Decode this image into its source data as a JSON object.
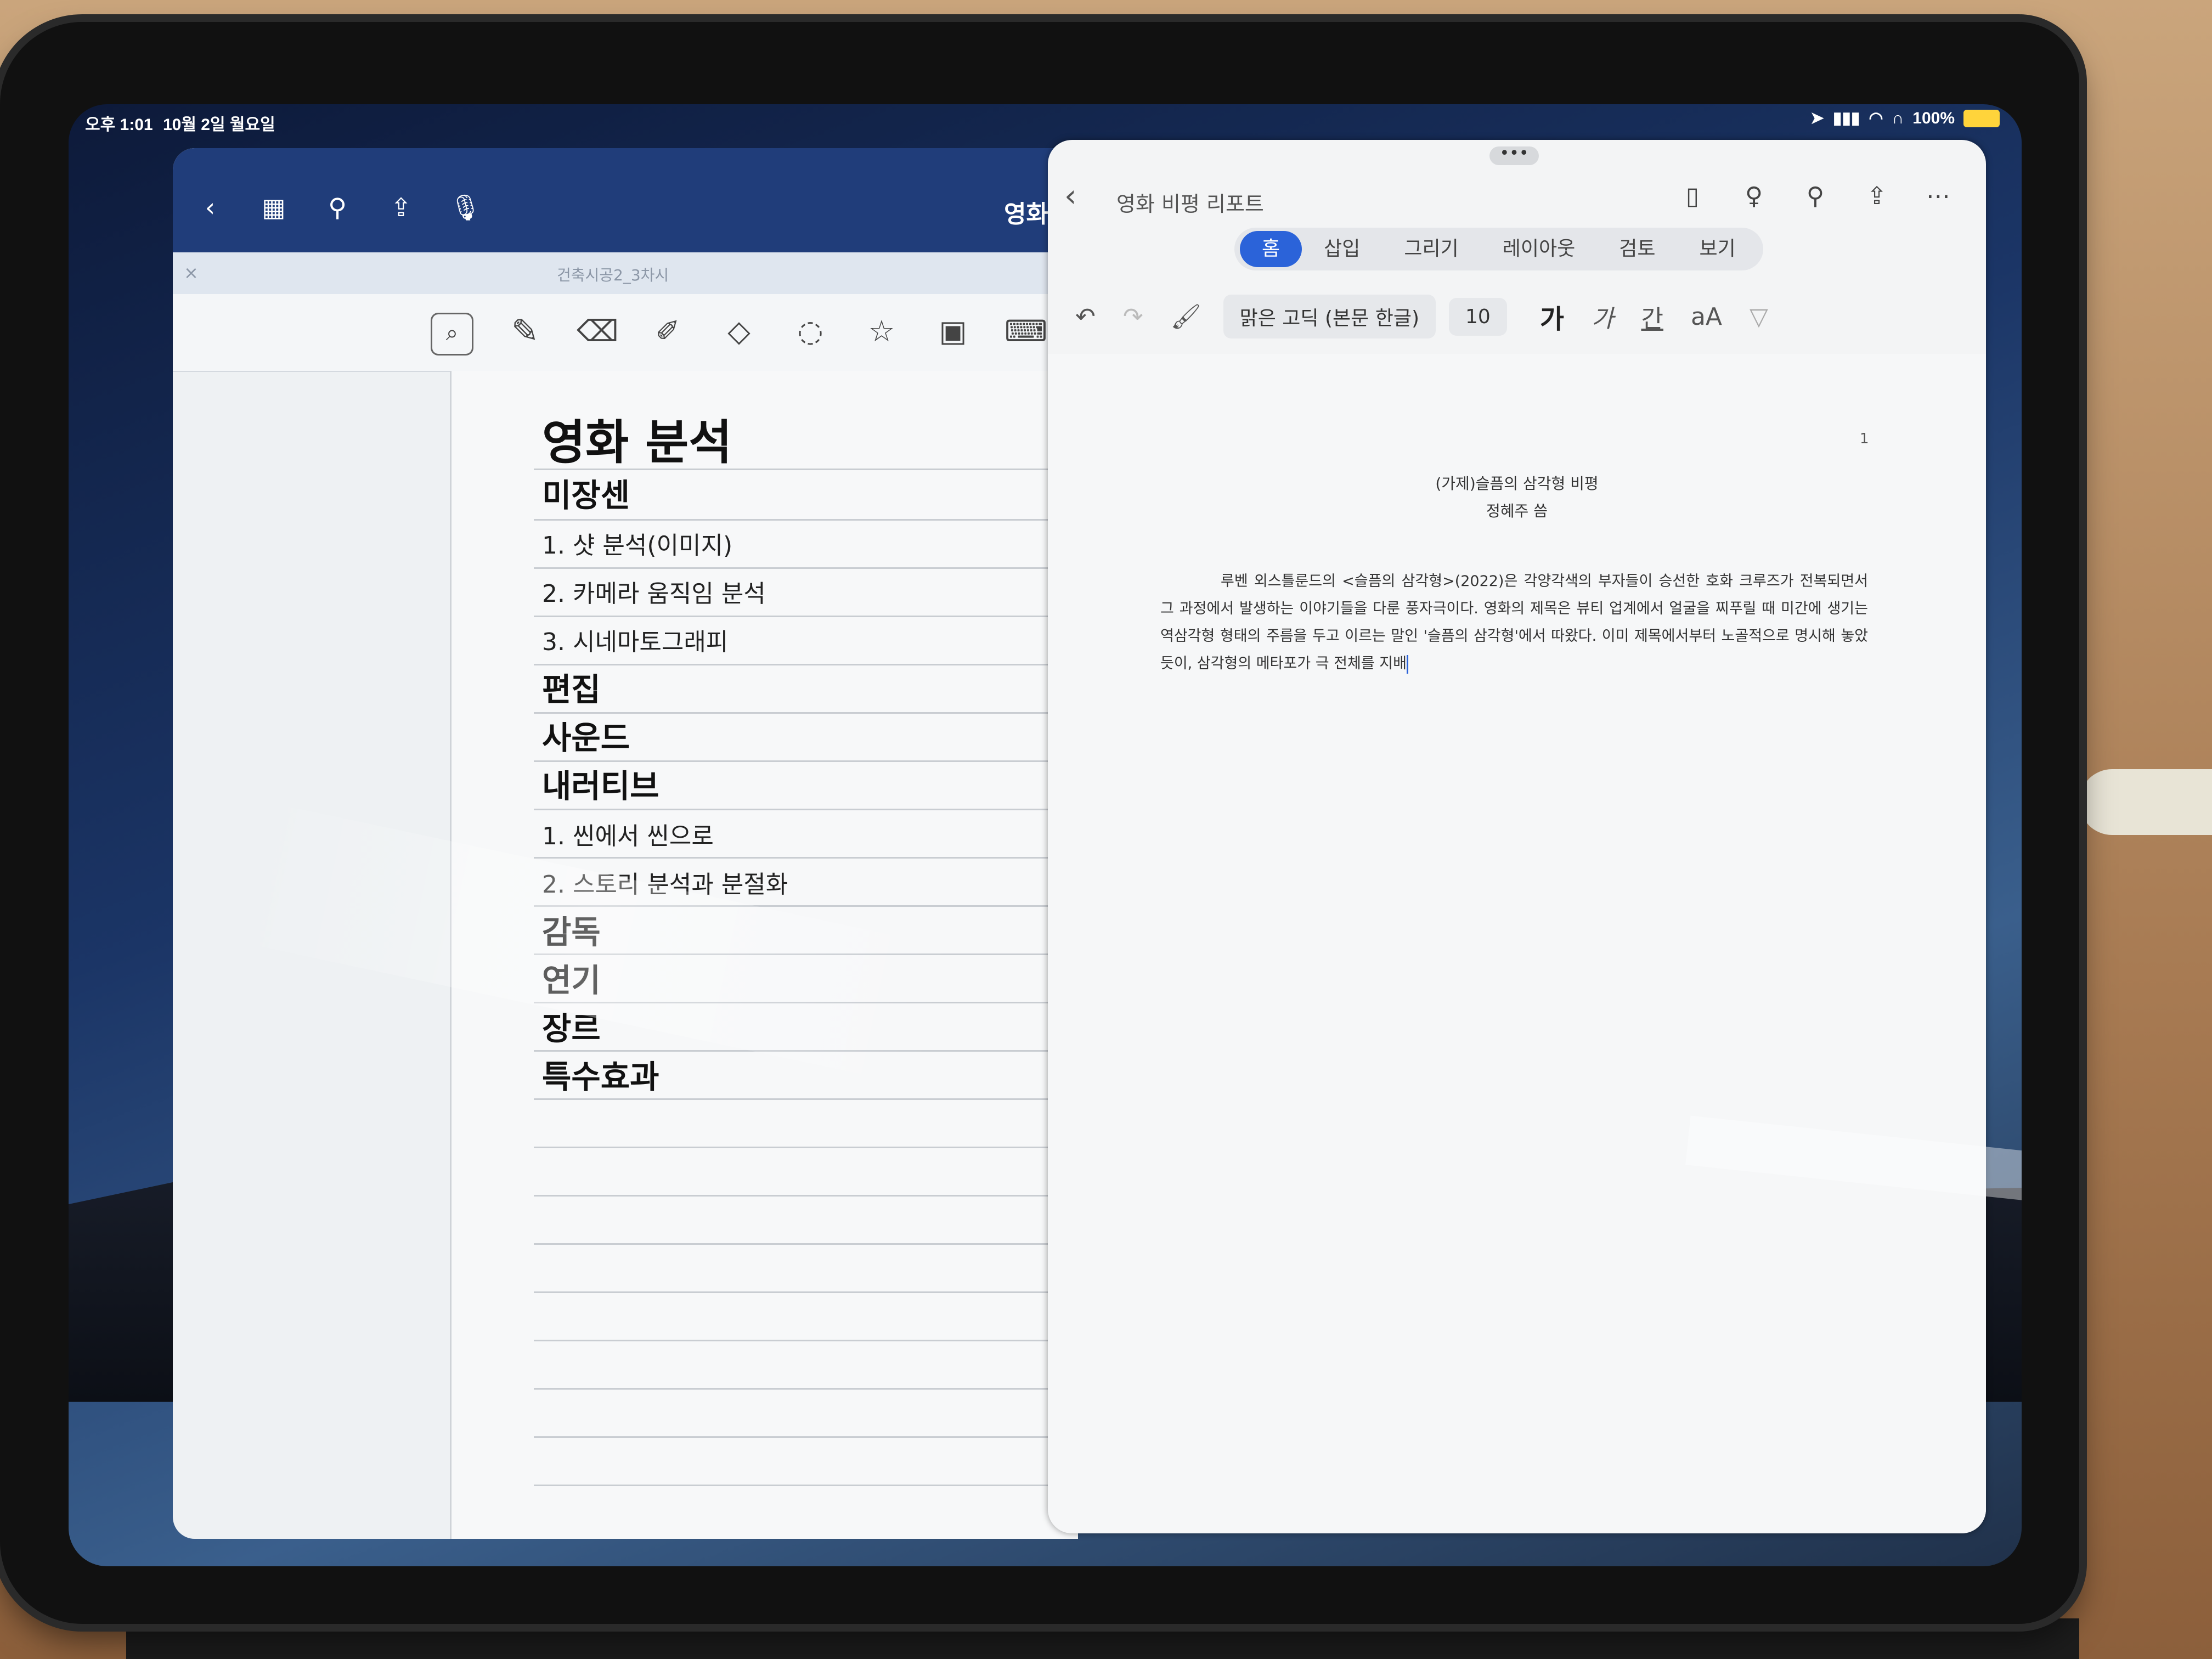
{
  "status_bar": {
    "time": "오후 1:01",
    "date": "10월 2일 월요일",
    "battery": "100%"
  },
  "notes_app": {
    "title": "영화",
    "tab_label": "건축시공2_3차시",
    "icons": [
      "back-icon",
      "grid-icon",
      "search-icon",
      "share-icon",
      "mic-icon"
    ],
    "tools": [
      "lasso-zoom-icon",
      "pen-icon",
      "eraser-icon",
      "highlighter-icon",
      "shapes-icon",
      "lasso-icon",
      "sticker-icon",
      "image-icon",
      "keyboard-icon"
    ],
    "content": [
      {
        "type": "h1",
        "text": "영화 분석"
      },
      {
        "type": "h2",
        "text": "미장센"
      },
      {
        "type": "item",
        "text": "1.   샷 분석(이미지)"
      },
      {
        "type": "item",
        "text": "2.   카메라 움직임 분석"
      },
      {
        "type": "item",
        "text": "3.   시네마토그래피"
      },
      {
        "type": "h2",
        "text": "편집"
      },
      {
        "type": "h2",
        "text": "사운드"
      },
      {
        "type": "h2",
        "text": "내러티브"
      },
      {
        "type": "item",
        "text": "1.   씬에서 씬으로"
      },
      {
        "type": "item",
        "text": "2.   스토리 분석과 분절화"
      },
      {
        "type": "h2",
        "text": "감독"
      },
      {
        "type": "h2",
        "text": "연기"
      },
      {
        "type": "h2",
        "text": "장르"
      },
      {
        "type": "h2",
        "text": "특수효과"
      }
    ]
  },
  "word_app": {
    "title": "영화 비평 리포트",
    "tabs": [
      "홈",
      "삽입",
      "그리기",
      "레이아웃",
      "검토",
      "보기"
    ],
    "active_tab": "홈",
    "font_name": "맑은 고딕 (본문 한글)",
    "font_size": "10",
    "format_labels": {
      "bold": "가",
      "italic": "가",
      "underline": "간",
      "case": "aA"
    },
    "page_number": "1",
    "doc_title": "(가제)슬픔의 삼각형 비평",
    "doc_author": "정혜주 씀",
    "doc_body": "루벤 외스틀룬드의 <슬픔의 삼각형>(2022)은 각양각색의 부자들이 승선한 호화 크루즈가 전복되면서 그 과정에서 발생하는 이야기들을 다룬 풍자극이다. 영화의 제목은 뷰티 업계에서 얼굴을 찌푸릴 때 미간에 생기는 역삼각형 형태의 주름을 두고 이르는 말인 '슬픔의 삼각형'에서 따왔다. 이미 제목에서부터 노골적으로 명시해 놓았듯이, 삼각형의 메타포가 극 전체를 지배"
  }
}
